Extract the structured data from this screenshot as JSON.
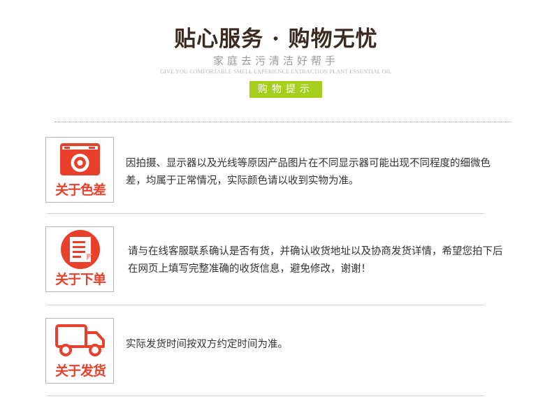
{
  "header": {
    "title": "贴心服务 · 购物无忧",
    "subtitle": "家庭去污清洁好帮手",
    "english": "GIVE YOU COMFORTABLE SMELL EXPERIENCE EXTRACTION PLANT ESSENTIAL OIL",
    "tag": "购物提示"
  },
  "sections": [
    {
      "icon": "camera-icon",
      "label": "关于色差",
      "text": "因拍摄、显示器以及光线等原因产品图片在不同显示器可能出现不同程度的细微色差，均属于正常情况，实际颜色请以收到实物为准。"
    },
    {
      "icon": "document-icon",
      "label": "关于下单",
      "text": "请与在线客服联系确认是否有货，并确认收货地址以及协商发货详情，希望您拍下后在网页上填写完整准确的收货信息，避免修改，谢谢！"
    },
    {
      "icon": "truck-icon",
      "label": "关于发货",
      "text": "实际发货时间按双方约定时间为准。"
    }
  ],
  "colors": {
    "accent_red": "#e8402a",
    "tag_green": "#a6cf1d",
    "title_brown": "#3b2a1f"
  }
}
